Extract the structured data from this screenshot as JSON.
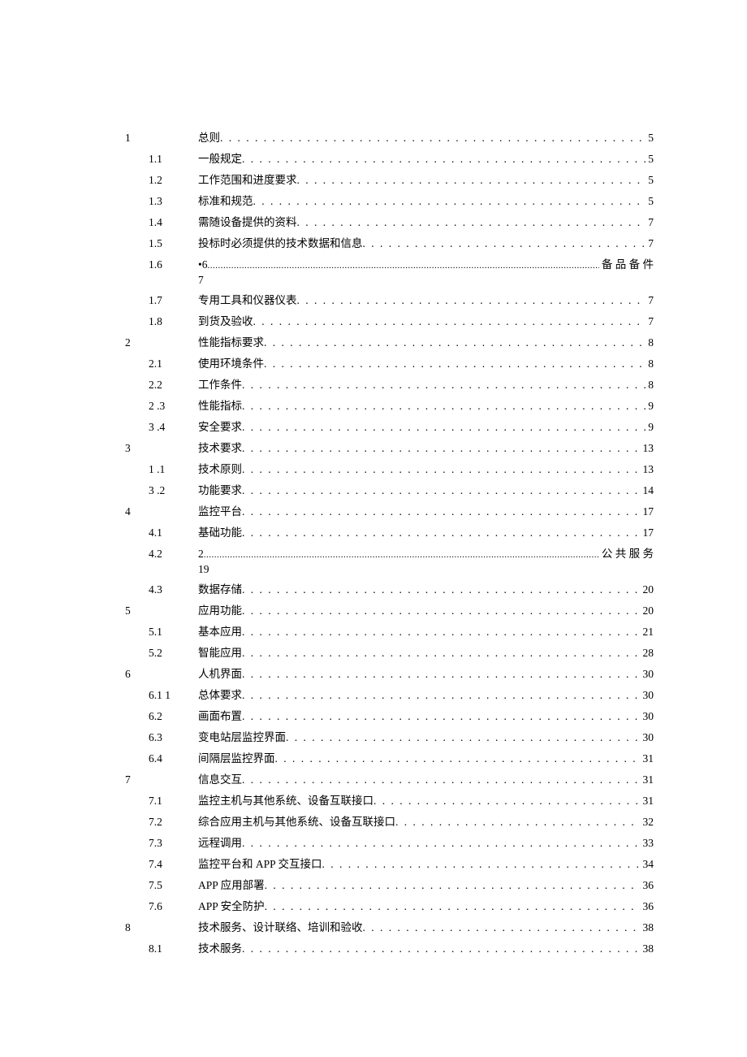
{
  "toc": [
    {
      "num": "1",
      "sub": "",
      "title": "总则",
      "page": "5",
      "style": "dots"
    },
    {
      "num": "",
      "sub": "1.1",
      "title": "一般规定",
      "page": "5",
      "style": "dots"
    },
    {
      "num": "",
      "sub": "1.2",
      "title": "工作范围和进度要求",
      "page": "5",
      "style": "dots"
    },
    {
      "num": "",
      "sub": "1.3",
      "title": "标准和规范",
      "page": "5",
      "style": "dots"
    },
    {
      "num": "",
      "sub": "1.4",
      "title": "需随设备提供的资料",
      "page": "7",
      "style": "dots"
    },
    {
      "num": "",
      "sub": "1.5",
      "title": "投标时必须提供的技术数据和信息",
      "page": "7",
      "style": "dots"
    },
    {
      "num": "",
      "sub": "1.6",
      "title": "•6",
      "trail": "备 品 备 件",
      "page": "",
      "style": "fine",
      "extra": "7"
    },
    {
      "num": "",
      "sub": "1.7",
      "title": "专用工具和仪器仪表",
      "page": "7",
      "style": "dots"
    },
    {
      "num": "",
      "sub": "1.8",
      "title": "到货及验收",
      "page": "7",
      "style": "dots"
    },
    {
      "num": "2",
      "sub": "",
      "title": "性能指标要求",
      "page": "8",
      "style": "dots"
    },
    {
      "num": "",
      "sub": "2.1",
      "title": "使用环境条件",
      "page": "8",
      "style": "dots"
    },
    {
      "num": "",
      "sub": "2.2",
      "title": "工作条件",
      "page": "8",
      "style": "dots"
    },
    {
      "num": "",
      "sub": "2   .3",
      "title": "性能指标",
      "page": "9",
      "style": "dots"
    },
    {
      "num": "",
      "sub": "3   .4",
      "title": "安全要求",
      "page": "9",
      "style": "dots"
    },
    {
      "num": "3",
      "sub": "",
      "title": "技术要求",
      "page": "13",
      "style": "dots"
    },
    {
      "num": "",
      "sub": "1   .1",
      "title": "技术原则",
      "page": "13",
      "style": "dots"
    },
    {
      "num": "",
      "sub": "3   .2",
      "title": "功能要求",
      "page": "14",
      "style": "dots"
    },
    {
      "num": "4",
      "sub": "",
      "title": "监控平台",
      "page": "17",
      "style": "dots"
    },
    {
      "num": "",
      "sub": "4.1",
      "title": "基础功能",
      "page": "17",
      "style": "dots"
    },
    {
      "num": "",
      "sub": "4.2",
      "title": "2",
      "trail": "公 共 服 务",
      "page": "",
      "style": "fine",
      "extra": "19"
    },
    {
      "num": "",
      "sub": "4.3",
      "title": "数据存储",
      "page": "20",
      "style": "dots"
    },
    {
      "num": "5",
      "sub": "",
      "title": "应用功能",
      "page": "20",
      "style": "dots"
    },
    {
      "num": "",
      "sub": "5.1",
      "title": "基本应用",
      "page": "21",
      "style": "dots"
    },
    {
      "num": "",
      "sub": "5.2",
      "title": "智能应用",
      "page": "28",
      "style": "dots"
    },
    {
      "num": "6",
      "sub": "",
      "title": "人机界面",
      "page": "30",
      "style": "dots"
    },
    {
      "num": "",
      "sub": "6.1 1",
      "title": "总体要求",
      "page": "30",
      "style": "dots"
    },
    {
      "num": "",
      "sub": "6.2",
      "title": "画面布置",
      "page": "30",
      "style": "dots"
    },
    {
      "num": "",
      "sub": "6.3",
      "title": "变电站层监控界面",
      "page": "30",
      "style": "dots"
    },
    {
      "num": "",
      "sub": "6.4",
      "title": "间隔层监控界面",
      "page": "31",
      "style": "dots"
    },
    {
      "num": "7",
      "sub": "",
      "title": "信息交互",
      "page": "31",
      "style": "dots"
    },
    {
      "num": "",
      "sub": "7.1",
      "title": "监控主机与其他系统、设备互联接口",
      "page": "31",
      "style": "dots"
    },
    {
      "num": "",
      "sub": "7.2",
      "title": "综合应用主机与其他系统、设备互联接口",
      "page": "32",
      "style": "dots"
    },
    {
      "num": "",
      "sub": "7.3",
      "title": "远程调用",
      "page": "33",
      "style": "dots"
    },
    {
      "num": "",
      "sub": "7.4",
      "title": "监控平台和 APP 交互接口",
      "page": "34",
      "style": "dots"
    },
    {
      "num": "",
      "sub": "7.5",
      "title": "APP 应用部署",
      "page": "36",
      "style": "dots"
    },
    {
      "num": "",
      "sub": "7.6",
      "title": "APP 安全防护",
      "page": "36",
      "style": "dots"
    },
    {
      "num": "8",
      "sub": "",
      "title": "技术服务、设计联络、培训和验收",
      "page": "38",
      "style": "dots"
    },
    {
      "num": "",
      "sub": "8.1",
      "title": "技术服务",
      "page": "38",
      "style": "dots"
    }
  ]
}
